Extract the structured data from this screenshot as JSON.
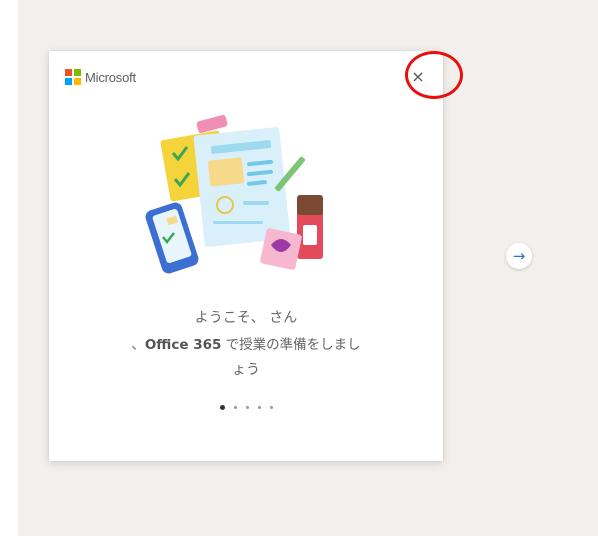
{
  "brand": {
    "name": "Microsoft",
    "colors": [
      "#f25022",
      "#7fba00",
      "#00a4ef",
      "#ffb900"
    ]
  },
  "dialog": {
    "close_icon": "×",
    "welcome_line1": "ようこそ、 さん",
    "welcome_line2_prefix": "、",
    "welcome_line2_product": "Office 365",
    "welcome_line2_suffix": " で授業の準備をしまし",
    "welcome_line3": "ょう"
  },
  "pager": {
    "total": 5,
    "active_index": 0
  },
  "next_arrow": "→",
  "highlight_color": "#e8100e"
}
